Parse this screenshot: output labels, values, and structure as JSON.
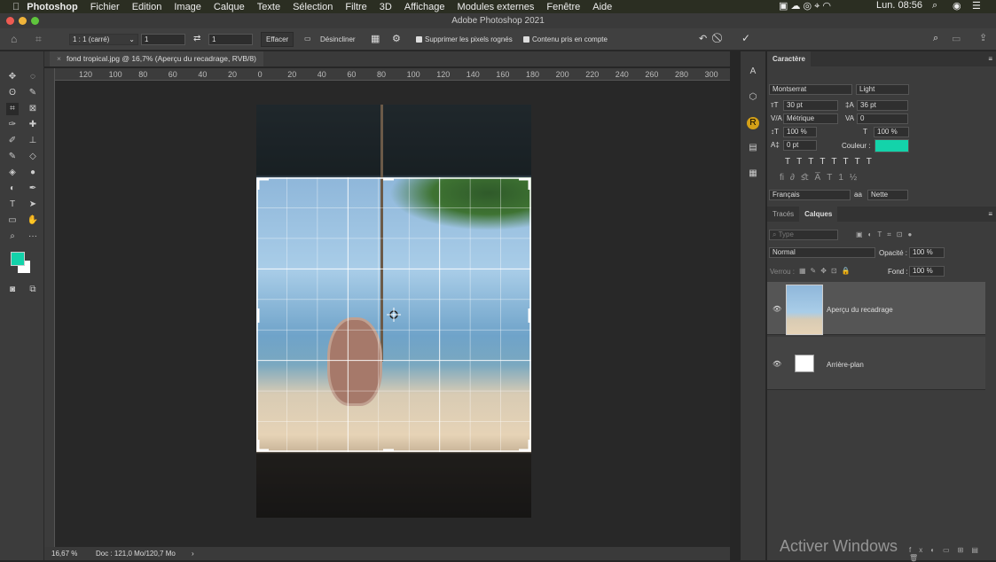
{
  "menubar": {
    "items": [
      "Photoshop",
      "Fichier",
      "Edition",
      "Image",
      "Calque",
      "Texte",
      "Sélection",
      "Filtre",
      "3D",
      "Affichage",
      "Modules externes",
      "Fenêtre",
      "Aide"
    ],
    "clock": "Lun. 08:56"
  },
  "window": {
    "title": "Adobe Photoshop 2021"
  },
  "options": {
    "ratio": "1 : 1 (carré)",
    "width": "1",
    "height": "1",
    "clear": "Effacer",
    "straighten": "Désincliner",
    "delete_cropped": "Supprimer les pixels rognés",
    "content_aware": "Contenu pris en compte"
  },
  "document": {
    "tab": "fond tropical.jpg @ 16,7% (Aperçu du recadrage, RVB/8)"
  },
  "ruler": {
    "h": [
      "120",
      "100",
      "80",
      "60",
      "40",
      "20",
      "0",
      "20",
      "40",
      "60",
      "80",
      "100",
      "120",
      "140",
      "160",
      "180",
      "200",
      "220",
      "240",
      "260",
      "280",
      "300"
    ]
  },
  "status": {
    "zoom": "16,67 %",
    "doc": "Doc : 121,0 Mo/120,7 Mo"
  },
  "character": {
    "title": "Caractère",
    "font": "Montserrat",
    "style": "Light",
    "size": "30 pt",
    "leading": "36 pt",
    "kerning": "Métrique",
    "tracking": "0",
    "vscale": "100 %",
    "hscale": "100 %",
    "baseline": "0 pt",
    "color_label": "Couleur :",
    "color": "#13d3aa",
    "language": "Français",
    "aa": "Nette"
  },
  "layers_panel": {
    "tabs": [
      "Tracés",
      "Calques"
    ],
    "search": "Type",
    "blend": "Normal",
    "opacity_label": "Opacité :",
    "opacity": "100 %",
    "lock_label": "Verrou :",
    "fill_label": "Fond :",
    "fill": "100 %",
    "layers": [
      {
        "name": "Aperçu du recadrage",
        "selected": true
      },
      {
        "name": "Arrière-plan",
        "selected": false
      }
    ]
  },
  "watermark": "Activer Windows",
  "colors": {
    "foreground": "#13d3aa",
    "background": "#ffffff"
  }
}
